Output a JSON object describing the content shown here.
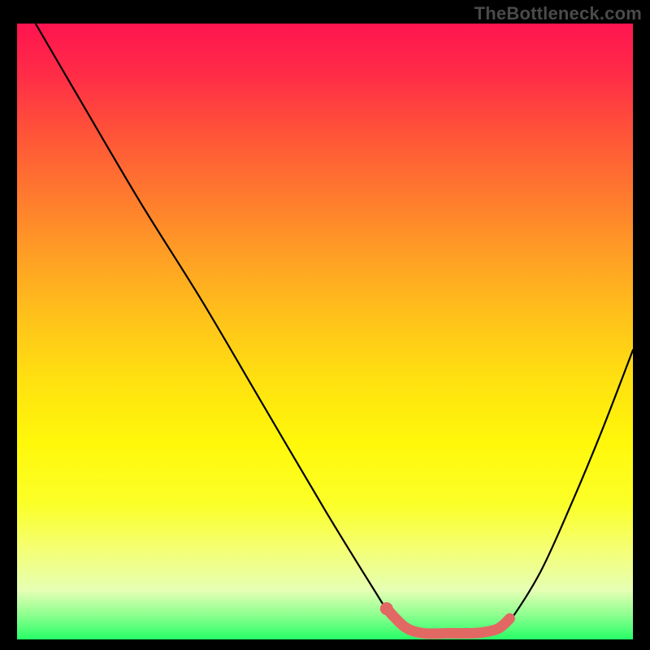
{
  "watermark": "TheBottleneck.com",
  "chart_data": {
    "type": "line",
    "title": "",
    "xlabel": "",
    "ylabel": "",
    "xlim": [
      0,
      100
    ],
    "ylim": [
      0,
      100
    ],
    "series": [
      {
        "name": "bottleneck-curve",
        "x": [
          3,
          10,
          20,
          30,
          40,
          50,
          58,
          60,
          63,
          66,
          70,
          74,
          78,
          80,
          85,
          90,
          95,
          100
        ],
        "values": [
          100,
          88,
          71,
          55,
          38,
          21,
          8,
          5,
          2,
          1,
          1,
          1,
          1.5,
          3,
          11,
          22,
          34,
          47
        ]
      },
      {
        "name": "highlight-segment",
        "x": [
          60,
          63,
          66,
          70,
          74,
          76,
          78,
          79,
          80
        ],
        "values": [
          5,
          2,
          1,
          1,
          1,
          1.2,
          1.7,
          2.4,
          3.4
        ]
      }
    ],
    "highlight_marker": {
      "x": 60,
      "y": 5
    }
  },
  "colors": {
    "curve": "#000000",
    "highlight": "#e26864",
    "background_top": "#ff1450",
    "background_bottom": "#26ff66"
  }
}
